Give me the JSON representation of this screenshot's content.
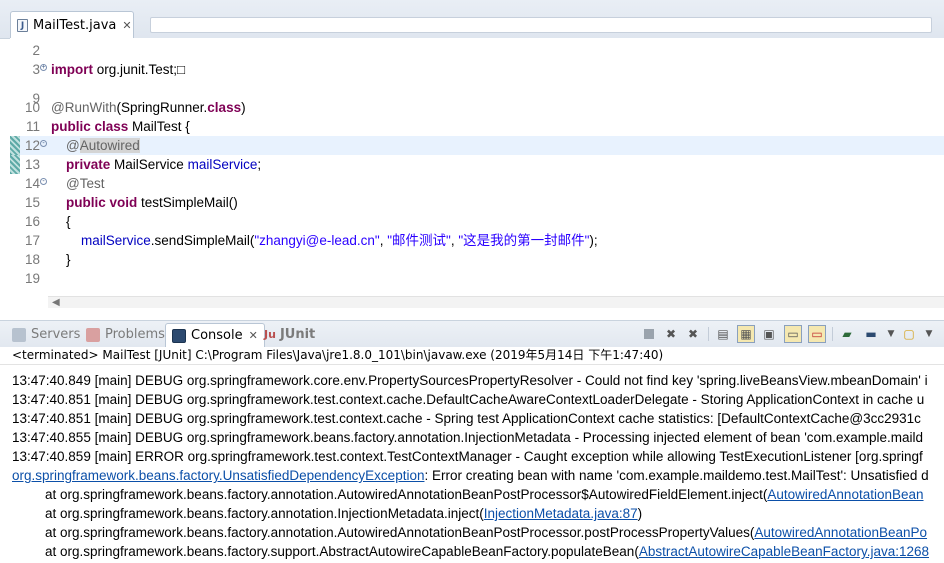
{
  "editor_tab": {
    "label": "MailTest.java"
  },
  "editor_lines": [
    {
      "n": "2",
      "tokens": []
    },
    {
      "n": "3",
      "fold": "+",
      "tokens": [
        {
          "t": "import",
          "c": "kw"
        },
        {
          "t": " org.junit.Test;"
        },
        {
          "t": "□"
        }
      ]
    },
    {
      "n": "9",
      "tokens": []
    },
    {
      "n": "10",
      "tokens": [
        {
          "t": "@RunWith",
          "c": "ann"
        },
        {
          "t": "(SpringRunner."
        },
        {
          "t": "class",
          "c": "kw"
        },
        {
          "t": ")"
        }
      ]
    },
    {
      "n": "11",
      "tokens": [
        {
          "t": "public class",
          "c": "kw"
        },
        {
          "t": " MailTest {"
        }
      ]
    },
    {
      "n": "12",
      "fold": "-",
      "current": true,
      "mark": true,
      "tokens": [
        {
          "t": "    "
        },
        {
          "t": "@",
          "c": "ann"
        },
        {
          "t": "Autowired",
          "c": "ann occ"
        }
      ]
    },
    {
      "n": "13",
      "mark": true,
      "tokens": [
        {
          "t": "    "
        },
        {
          "t": "private",
          "c": "kw"
        },
        {
          "t": " MailService "
        },
        {
          "t": "mailService",
          "c": "fld"
        },
        {
          "t": ";"
        }
      ]
    },
    {
      "n": "14",
      "fold": "-",
      "tokens": [
        {
          "t": "    "
        },
        {
          "t": "@Test",
          "c": "ann"
        }
      ]
    },
    {
      "n": "15",
      "tokens": [
        {
          "t": "    "
        },
        {
          "t": "public void",
          "c": "kw"
        },
        {
          "t": " testSimpleMail()"
        }
      ]
    },
    {
      "n": "16",
      "tokens": [
        {
          "t": "    {"
        }
      ]
    },
    {
      "n": "17",
      "tokens": [
        {
          "t": "        "
        },
        {
          "t": "mailService",
          "c": "fld"
        },
        {
          "t": ".sendSimpleMail("
        },
        {
          "t": "\"zhangyi@e-lead.cn\"",
          "c": "str"
        },
        {
          "t": ", "
        },
        {
          "t": "\"邮件测试\"",
          "c": "str"
        },
        {
          "t": ", "
        },
        {
          "t": "\"这是我的第一封邮件\"",
          "c": "str"
        },
        {
          "t": ");"
        }
      ]
    },
    {
      "n": "18",
      "tokens": [
        {
          "t": "    }"
        }
      ]
    },
    {
      "n": "19",
      "tokens": []
    }
  ],
  "view_tabs": [
    {
      "label": "Servers",
      "icon": "servers-icon",
      "active": false
    },
    {
      "label": "Problems",
      "icon": "problems-icon",
      "active": false
    },
    {
      "label": "Console",
      "icon": "console-icon",
      "active": true,
      "close": "✕"
    },
    {
      "label": "JUnit",
      "icon": "junit-icon",
      "active": false
    }
  ],
  "console": {
    "header": "<terminated> MailTest [JUnit] C:\\Program Files\\Java\\jre1.8.0_101\\bin\\javaw.exe (2019年5月14日 下午1:47:40)",
    "lines": [
      {
        "parts": [
          {
            "t": "13:47:40.849 [main] DEBUG org.springframework.core.env.PropertySourcesPropertyResolver - Could not find key 'spring.liveBeansView.mbeanDomain' i"
          }
        ]
      },
      {
        "parts": [
          {
            "t": "13:47:40.851 [main] DEBUG org.springframework.test.context.cache.DefaultCacheAwareContextLoaderDelegate - Storing ApplicationContext in cache u"
          }
        ]
      },
      {
        "parts": [
          {
            "t": "13:47:40.851 [main] DEBUG org.springframework.test.context.cache - Spring test ApplicationContext cache statistics: [DefaultContextCache@3cc2931c"
          }
        ]
      },
      {
        "parts": [
          {
            "t": "13:47:40.855 [main] DEBUG org.springframework.beans.factory.annotation.InjectionMetadata - Processing injected element of bean 'com.example.maild"
          }
        ]
      },
      {
        "parts": [
          {
            "t": "13:47:40.859 [main] ERROR org.springframework.test.context.TestContextManager - Caught exception while allowing TestExecutionListener [org.springf"
          }
        ]
      },
      {
        "parts": [
          {
            "t": "org.springframework.beans.factory.UnsatisfiedDependencyException",
            "link": true
          },
          {
            "t": ": Error creating bean with name 'com.example.maildemo.test.MailTest': Unsatisfied d"
          }
        ]
      },
      {
        "parts": [
          {
            "t": "\tat org.springframework.beans.factory.annotation.AutowiredAnnotationBeanPostProcessor$AutowiredFieldElement.inject("
          },
          {
            "t": "AutowiredAnnotationBean",
            "link": true
          }
        ]
      },
      {
        "parts": [
          {
            "t": "\tat org.springframework.beans.factory.annotation.InjectionMetadata.inject("
          },
          {
            "t": "InjectionMetadata.java:87",
            "link": true
          },
          {
            "t": ")"
          }
        ]
      },
      {
        "parts": [
          {
            "t": "\tat org.springframework.beans.factory.annotation.AutowiredAnnotationBeanPostProcessor.postProcessPropertyValues("
          },
          {
            "t": "AutowiredAnnotationBeanPo",
            "link": true
          }
        ]
      },
      {
        "parts": [
          {
            "t": "\tat org.springframework.beans.factory.support.AbstractAutowireCapableBeanFactory.populateBean("
          },
          {
            "t": "AbstractAutowireCapableBeanFactory.java:1268",
            "link": true
          }
        ]
      }
    ]
  },
  "toolbar_icons": [
    "stop-icon",
    "remove-launch-icon",
    "remove-all-launches-icon",
    "scroll-lock-icon",
    "word-wrap-icon",
    "pin-console-icon",
    "show-stdout-icon",
    "show-stderr-icon",
    "open-console-icon",
    "display-selected-console-icon",
    "new-console-icon"
  ]
}
